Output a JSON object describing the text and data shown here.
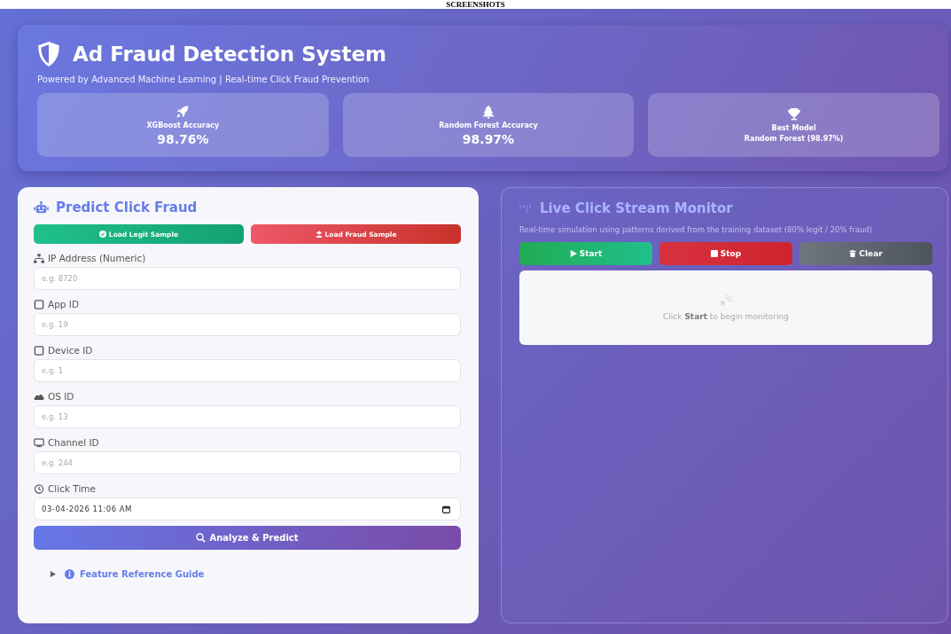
{
  "caption": "SCREENSHOTS",
  "header": {
    "title": "Ad Fraud Detection System",
    "subtitle": "Powered by Advanced Machine Learning | Real-time Click Fraud Prevention",
    "stats": [
      {
        "label": "XGBoost Accuracy",
        "value": "98.76%",
        "kind": "big"
      },
      {
        "label": "Random Forest Accuracy",
        "value": "98.97%",
        "kind": "big"
      },
      {
        "label": "Best Model",
        "value": "Random Forest (98.97%)",
        "kind": "small"
      }
    ]
  },
  "predict": {
    "title": "Predict Click Fraud",
    "samples": [
      {
        "label": "Load Legit Sample",
        "kind": "legit"
      },
      {
        "label": "Load Fraud Sample",
        "kind": "fraud"
      }
    ],
    "fields": [
      {
        "label": "IP Address (Numeric)",
        "placeholder": "e.g. 8720",
        "kind": "text"
      },
      {
        "label": "App ID",
        "placeholder": "e.g. 19",
        "kind": "text"
      },
      {
        "label": "Device ID",
        "placeholder": "e.g. 1",
        "kind": "text"
      },
      {
        "label": "OS ID",
        "placeholder": "e.g. 13",
        "kind": "text"
      },
      {
        "label": "Channel ID",
        "placeholder": "e.g. 244",
        "kind": "text"
      },
      {
        "label": "Click Time",
        "value": "03-04-2026 11:06 AM",
        "kind": "datetime"
      }
    ],
    "analyze": "Analyze & Predict",
    "guide": {
      "label": "Feature Reference Guide",
      "expanded": false
    }
  },
  "monitor": {
    "title": "Live Click Stream Monitor",
    "description": "Real-time simulation using patterns derived from the training dataset (80% legit / 20% fraud)",
    "controls": [
      {
        "label": "Start",
        "kind": "start"
      },
      {
        "label": "Stop",
        "kind": "stop"
      },
      {
        "label": "Clear",
        "kind": "clear"
      }
    ],
    "empty": "Click **Start** to begin monitoring"
  }
}
